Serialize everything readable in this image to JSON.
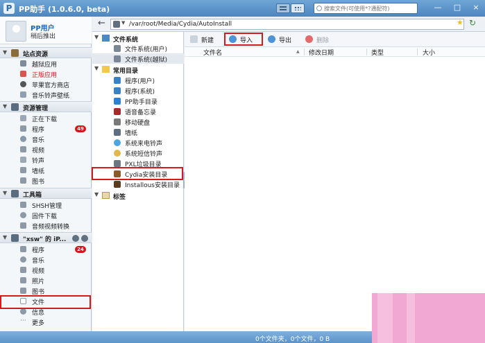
{
  "app": {
    "title": "PP助手 (1.0.6.0, beta)"
  },
  "search": {
    "placeholder": "搜索文件(可使用*?通配符)"
  },
  "window_buttons": [
    "—",
    "□",
    "×"
  ],
  "user": {
    "name": "PP用户",
    "status": "稍后推出"
  },
  "sidebar": {
    "sections": [
      {
        "title": "站点资源",
        "items": [
          "越狱应用",
          "正版应用",
          "苹果官方商店",
          "音乐铃声壁纸"
        ]
      },
      {
        "title": "资源管理",
        "items": [
          "正在下载",
          "程序",
          "音乐",
          "视频",
          "铃声",
          "墙纸",
          "图书"
        ],
        "badge": "49"
      },
      {
        "title": "工具箱",
        "items": [
          "SHSH管理",
          "固件下载",
          "音频视频转换"
        ]
      },
      {
        "title": "\"xsw\" 的 iP...",
        "items": [
          "程序",
          "音乐",
          "视频",
          "照片",
          "图书",
          "文件",
          "信息",
          "更多"
        ],
        "badge": "24"
      }
    ]
  },
  "path": {
    "value": "/var/root/Media/Cydia/AutoInstall"
  },
  "tree": {
    "fs_title": "文件系统",
    "fs_items": [
      "文件系统(用户)",
      "文件系统(越狱)"
    ],
    "common_title": "常用目录",
    "common_items": [
      "程序(用户)",
      "程序(系统)",
      "PP助手目录",
      "语音备忘录",
      "移动硬盘",
      "墙纸",
      "系统来电铃声",
      "系统短信铃声",
      "PXL垃圾目录",
      "Cydia安装目录",
      "Installous安装目录"
    ],
    "tags_title": "标签"
  },
  "actions": {
    "new": "新建",
    "import": "导入",
    "export": "导出",
    "delete": "删除"
  },
  "columns": {
    "name": "文件名",
    "modified": "修改日期",
    "type": "类型",
    "size": "大小"
  },
  "status": {
    "text": "0个文件夹，0个文件，0 B"
  },
  "colors": {
    "accent": "#4d86bf",
    "highlight": "#d21b1b",
    "badge": "#d0181b"
  }
}
